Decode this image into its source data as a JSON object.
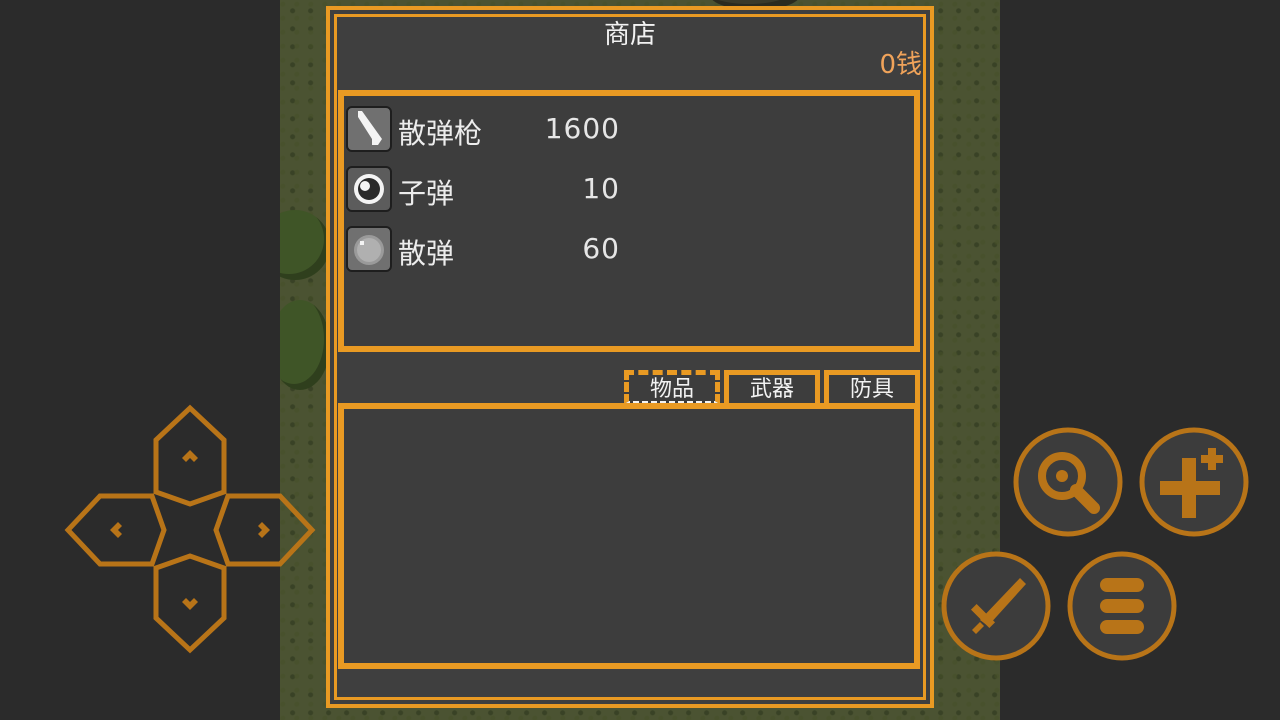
{
  "shop": {
    "title": "商店",
    "money": "0钱"
  },
  "items": [
    {
      "name": "散弹枪",
      "price": "1600",
      "icon": "shotgun-icon"
    },
    {
      "name": "子弹",
      "price": "10",
      "icon": "bullet-icon"
    },
    {
      "name": "散弹",
      "price": "60",
      "icon": "shell-icon"
    }
  ],
  "tabs": [
    {
      "label": "物品",
      "active": true
    },
    {
      "label": "武器",
      "active": false
    },
    {
      "label": "防具",
      "active": false
    }
  ],
  "colors": {
    "accent": "#e99a23",
    "panel": "#3d3d3d",
    "money": "#f0a35a",
    "control": "#b87418"
  },
  "controls": [
    "dpad-up",
    "dpad-down",
    "dpad-left",
    "dpad-right",
    "search-button",
    "add-button",
    "attack-button",
    "menu-button"
  ]
}
